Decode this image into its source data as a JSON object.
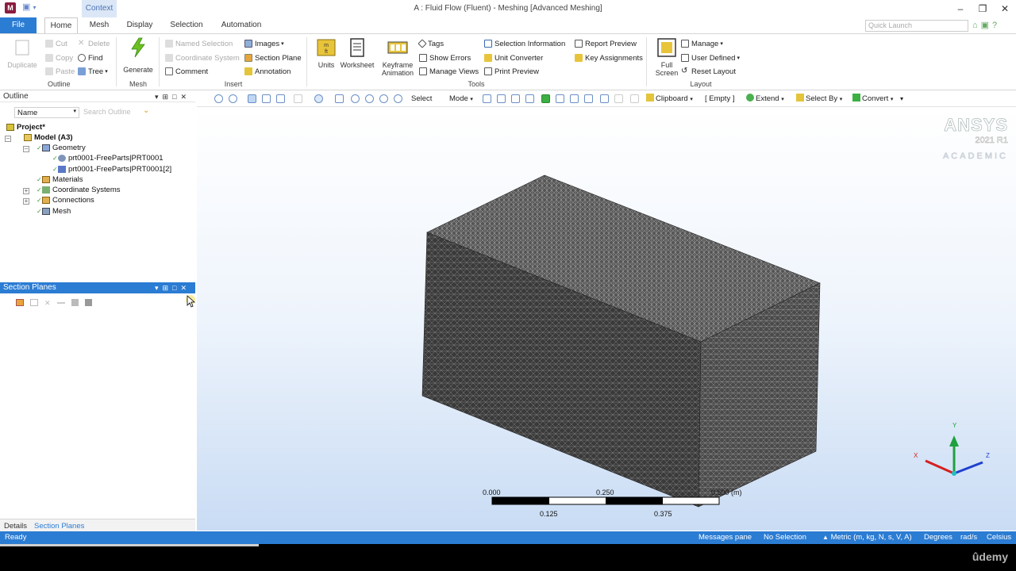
{
  "title_bar": {
    "app_icon": "M",
    "context_tab": "Context",
    "window_title": "A : Fluid Flow (Fluent) - Meshing [Advanced Meshing]",
    "controls": [
      "minimize-icon",
      "restore-icon",
      "close-icon"
    ]
  },
  "ribbon_tabs": {
    "file": "File",
    "tabs": [
      "Home",
      "Mesh",
      "Display",
      "Selection",
      "Automation"
    ],
    "active": "Home",
    "quick_launch_placeholder": "Quick Launch"
  },
  "ribbon": {
    "outline": {
      "label": "Outline",
      "duplicate": "Duplicate",
      "cut": "Cut",
      "copy": "Copy",
      "paste": "Paste",
      "delete": "Delete",
      "find": "Find",
      "tree": "Tree"
    },
    "mesh": {
      "label": "Mesh",
      "generate": "Generate"
    },
    "insert": {
      "label": "Insert",
      "named_selection": "Named Selection",
      "coordinate_system": "Coordinate System",
      "comment": "Comment",
      "images": "Images",
      "section_plane": "Section Plane",
      "annotation": "Annotation"
    },
    "tools": {
      "label": "Tools",
      "units": "Units",
      "worksheet": "Worksheet",
      "keyframe_animation_1": "Keyframe",
      "keyframe_animation_2": "Animation",
      "tags": "Tags",
      "show_errors": "Show Errors",
      "manage_views": "Manage Views",
      "selection_information": "Selection Information",
      "unit_converter": "Unit Converter",
      "print_preview": "Print Preview",
      "report_preview": "Report Preview",
      "key_assignments": "Key Assignments"
    },
    "layout": {
      "label": "Layout",
      "full_screen_1": "Full",
      "full_screen_2": "Screen",
      "manage": "Manage",
      "user_defined": "User Defined",
      "reset_layout": "Reset Layout"
    }
  },
  "outline_panel": {
    "title": "Outline",
    "filter_label": "Name",
    "search_placeholder": "Search Outline",
    "tree": [
      {
        "label": "Project*",
        "icon": "project-icon"
      },
      {
        "label": "Model (A3)",
        "icon": "model-icon"
      },
      {
        "label": "Geometry",
        "icon": "geometry-icon"
      },
      {
        "label": "prt0001-FreeParts|PRT0001",
        "icon": "solid-body-icon"
      },
      {
        "label": "prt0001-FreeParts|PRT0001[2]",
        "icon": "solid-body-icon"
      },
      {
        "label": "Materials",
        "icon": "materials-icon"
      },
      {
        "label": "Coordinate Systems",
        "icon": "coordinate-systems-icon"
      },
      {
        "label": "Connections",
        "icon": "connections-icon"
      },
      {
        "label": "Mesh",
        "icon": "mesh-icon"
      }
    ]
  },
  "section_planes_panel": {
    "title": "Section Planes"
  },
  "viewport_toolbar": {
    "select": "Select",
    "mode": "Mode",
    "clipboard": "Clipboard",
    "empty": "[ Empty ]",
    "extend": "Extend",
    "select_by": "Select By",
    "convert": "Convert"
  },
  "brand": {
    "name": "ANSYS",
    "version": "2021 R1",
    "edition": "ACADEMIC"
  },
  "scale_bar": {
    "top_labels": [
      "0.000",
      "0.250",
      "0.500 (m)"
    ],
    "bottom_labels": [
      "0.125",
      "0.375"
    ]
  },
  "triad": {
    "x": "X",
    "y": "Y",
    "z": "Z"
  },
  "bottom_tabs": {
    "details": "Details",
    "section_planes": "Section Planes",
    "active": "Section Planes"
  },
  "status_bar": {
    "ready": "Ready",
    "messages_pane": "Messages pane",
    "selection": "No Selection",
    "units": "Metric (m, kg, N, s, V, A)",
    "angle": "Degrees",
    "angular_velocity": "rad/s",
    "temperature": "Celsius"
  },
  "watermark": "ûdemy",
  "colors": {
    "accent_blue": "#2b7cd3",
    "mesh_dark": "#3a3a3a",
    "triad_x": "#d42020",
    "triad_y": "#20a040",
    "triad_z": "#2040d0"
  }
}
